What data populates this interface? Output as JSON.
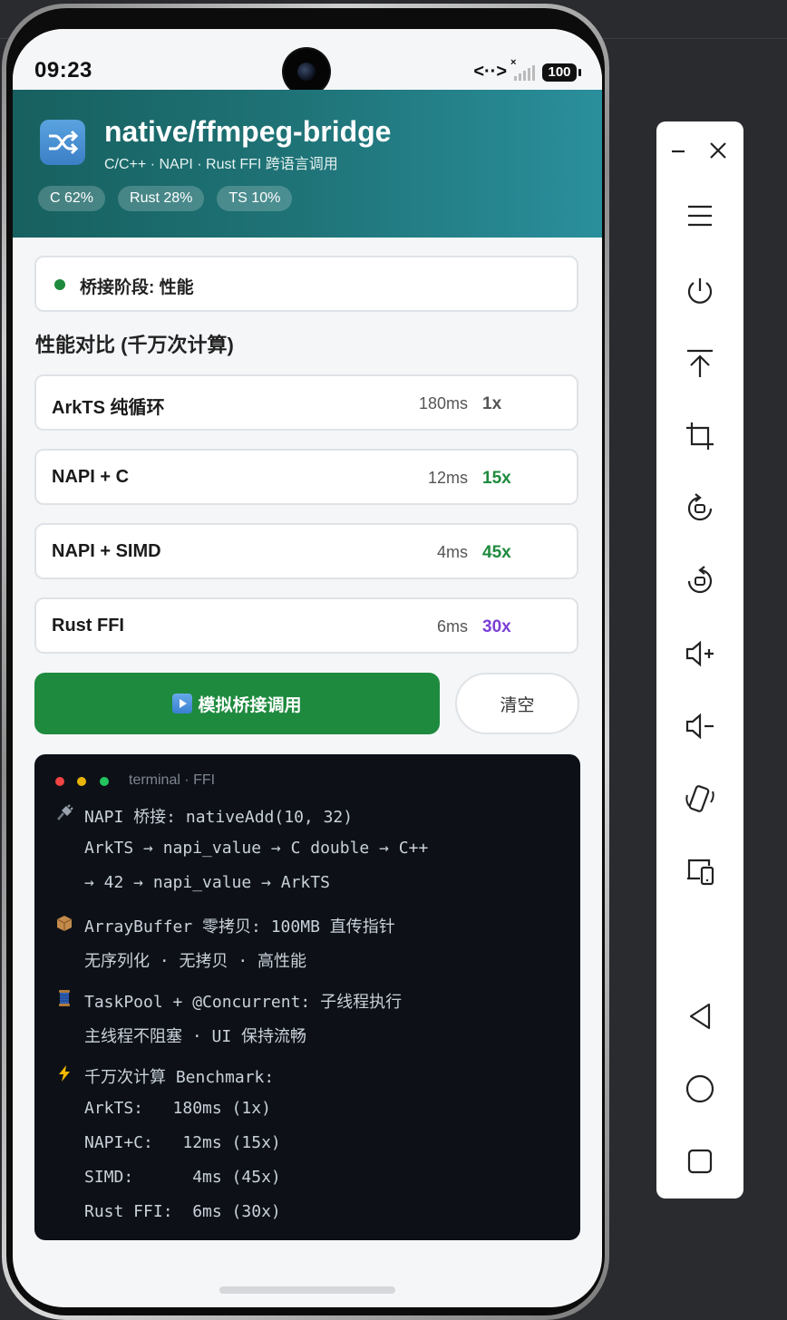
{
  "status_bar": {
    "time": "09:23",
    "battery": "100"
  },
  "header": {
    "repo_name": "native/ffmpeg-bridge",
    "subtitle": "C/C++ · NAPI · Rust FFI 跨语言调用",
    "languages": [
      {
        "label": "C 62%"
      },
      {
        "label": "Rust 28%"
      },
      {
        "label": "TS 10%"
      }
    ]
  },
  "stage": {
    "label": "桥接阶段: 性能",
    "status_color": "#1e8a3e"
  },
  "perf": {
    "title": "性能对比 (千万次计算)",
    "rows": [
      {
        "name": "ArkTS 纯循环",
        "time": "180ms",
        "speed": "1x",
        "color": "#555555"
      },
      {
        "name": "NAPI + C",
        "time": "12ms",
        "speed": "15x",
        "color": "#1e8a3e"
      },
      {
        "name": "NAPI + SIMD",
        "time": "4ms",
        "speed": "45x",
        "color": "#1e8a3e"
      },
      {
        "name": "Rust FFI",
        "time": "6ms",
        "speed": "30x",
        "color": "#7b3fd6"
      }
    ]
  },
  "actions": {
    "simulate_label": "模拟桥接调用",
    "clear_label": "清空"
  },
  "terminal": {
    "title": "terminal · FFI",
    "lines": [
      "NAPI 桥接: nativeAdd(10, 32)",
      "ArkTS → napi_value → C double → C++",
      "→ 42 → napi_value → ArkTS",
      "ArrayBuffer 零拷贝: 100MB 直传指针",
      "无序列化 · 无拷贝 · 高性能",
      "TaskPool + @Concurrent: 子线程执行",
      "主线程不阻塞 · UI 保持流畅",
      "千万次计算 Benchmark:",
      "ArkTS:   180ms (1x)",
      "NAPI+C:   12ms (15x)",
      "SIMD:      4ms (45x)",
      "Rust FFI:  6ms (30x)"
    ]
  },
  "toolbar": {
    "icons": [
      "minimize-icon",
      "close-icon",
      "menu-icon",
      "power-icon",
      "pin-top-icon",
      "crop-icon",
      "rotate-left-icon",
      "rotate-right-icon",
      "volume-up-icon",
      "volume-down-icon",
      "shake-icon",
      "multi-device-icon",
      "back-icon",
      "home-icon",
      "recents-icon"
    ]
  },
  "colors": {
    "header_start": "#17605f",
    "header_end": "#2a8f9c",
    "accent_green": "#1e8a3e",
    "accent_purple": "#7b3fd6",
    "terminal_bg": "#0d1117"
  }
}
